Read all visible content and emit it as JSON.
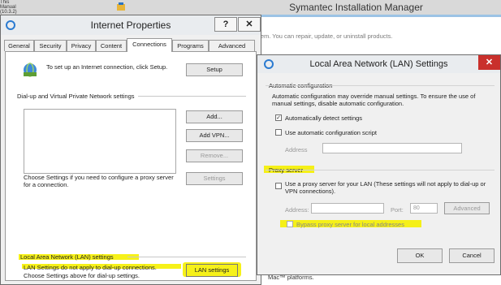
{
  "background_window": {
    "title": "Symantec Installation Manager",
    "description_text": "stem. You can repair, update, or uninstall products.",
    "footer_text": "Mac™ platforms.",
    "corner_text": "This Manual (10.3.2)"
  },
  "internet_properties": {
    "title": "Internet Properties",
    "help_label": "?",
    "close_label": "✕",
    "tabs": [
      "General",
      "Security",
      "Privacy",
      "Content",
      "Connections",
      "Programs",
      "Advanced"
    ],
    "active_tab": "Connections",
    "setup_text": "To set up an Internet connection, click Setup.",
    "setup_button": "Setup",
    "dialup_heading": "Dial-up and Virtual Private Network settings",
    "add_button": "Add...",
    "add_vpn_button": "Add VPN...",
    "remove_button": "Remove...",
    "proxy_text": "Choose Settings if you need to configure a proxy server for a connection.",
    "settings_button": "Settings",
    "lan_heading": "Local Area Network (LAN) settings",
    "lan_text_1": "LAN Settings do not apply to dial-up connections.",
    "lan_text_2": "Choose Settings above for dial-up settings.",
    "lan_settings_button": "LAN settings"
  },
  "lan_dialog": {
    "title": "Local Area Network (LAN) Settings",
    "close_label": "✕",
    "auto_config_heading": "Automatic configuration",
    "auto_config_text": "Automatic configuration may override manual settings.  To ensure the use of manual settings, disable automatic configuration.",
    "auto_detect_label": "Automatically detect settings",
    "auto_detect_checked": true,
    "auto_script_label": "Use automatic configuration script",
    "auto_script_checked": false,
    "address_label": "Address",
    "address_value": "",
    "proxy_heading": "Proxy server",
    "use_proxy_label": "Use a proxy server for your LAN (These settings will not apply to dial-up or VPN connections).",
    "use_proxy_checked": false,
    "proxy_address_label": "Address:",
    "proxy_address_value": "",
    "port_label": "Port:",
    "port_value": "80",
    "advanced_button": "Advanced",
    "bypass_label": "Bypass proxy server for local addresses",
    "bypass_checked": false,
    "ok_button": "OK",
    "cancel_button": "Cancel"
  },
  "colors": {
    "highlight": "#f5f000",
    "close_red": "#c9302c",
    "tab_blue": "#9cc3e5"
  }
}
